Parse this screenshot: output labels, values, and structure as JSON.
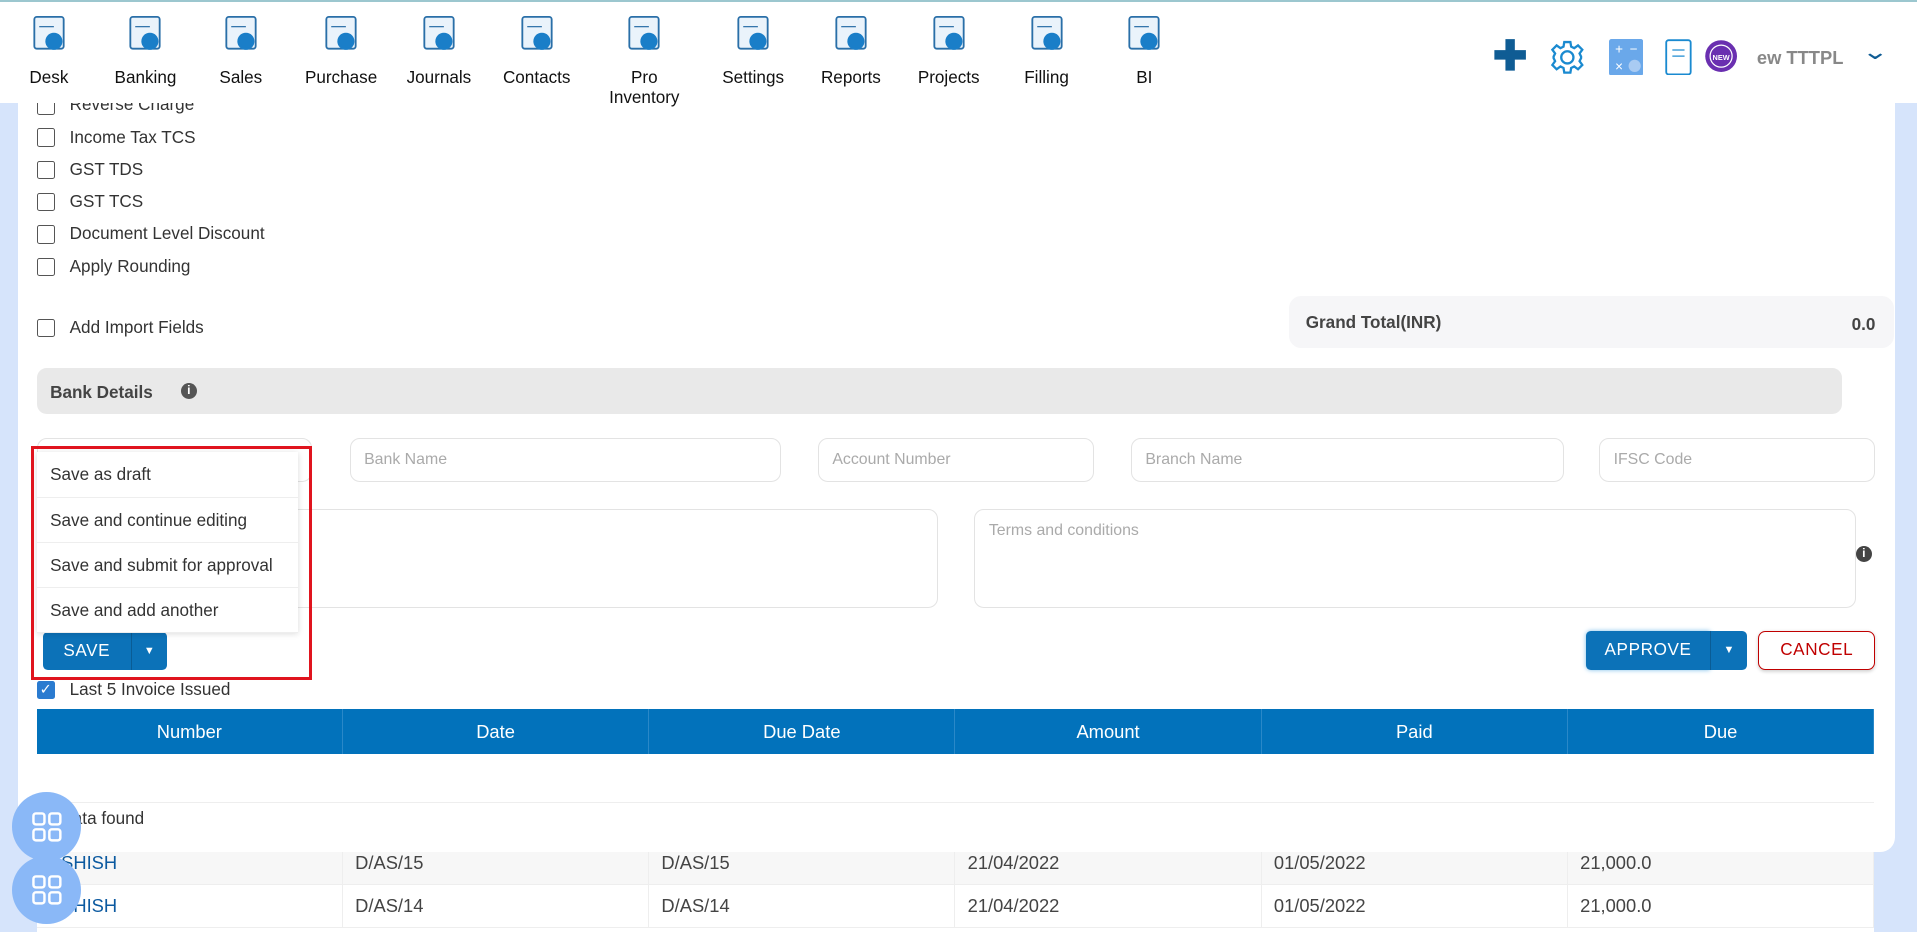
{
  "nav": {
    "items": [
      {
        "label": "Desk",
        "icon": "desk-icon"
      },
      {
        "label": "Banking",
        "icon": "bank-icon"
      },
      {
        "label": "Sales",
        "icon": "sales-icon"
      },
      {
        "label": "Purchase",
        "icon": "purchase-icon"
      },
      {
        "label": "Journals",
        "icon": "journals-icon"
      },
      {
        "label": "Contacts",
        "icon": "contacts-icon"
      },
      {
        "label": "Pro Inventory",
        "icon": "inventory-icon"
      },
      {
        "label": "Settings",
        "icon": "settings-icon"
      },
      {
        "label": "Reports",
        "icon": "reports-icon"
      },
      {
        "label": "Projects",
        "icon": "projects-icon"
      },
      {
        "label": "Filling",
        "icon": "filling-icon"
      },
      {
        "label": "BI",
        "icon": "bi-icon"
      }
    ],
    "company": "ew TTTPL",
    "new_badge": "NEW"
  },
  "options": [
    {
      "label": "Reverse Charge",
      "checked": false
    },
    {
      "label": "Income Tax TCS",
      "checked": false
    },
    {
      "label": "GST TDS",
      "checked": false
    },
    {
      "label": "GST TCS",
      "checked": false
    },
    {
      "label": "Document Level Discount",
      "checked": false
    },
    {
      "label": "Apply Rounding",
      "checked": false
    }
  ],
  "import_fields": "Add Import Fields",
  "grand_total": {
    "label": "Grand Total(INR)",
    "value": "0.0"
  },
  "bank_details": {
    "title": "Bank Details",
    "bank_name": "Bank Name",
    "account_number": "Account Number",
    "branch_name": "Branch Name",
    "ifsc": "IFSC Code"
  },
  "terms_placeholder": "Terms and conditions",
  "save_menu": [
    "Save as draft",
    "Save and continue editing",
    "Save and submit for approval",
    "Save and add another"
  ],
  "buttons": {
    "save": "SAVE",
    "approve": "APPROVE",
    "cancel": "CANCEL"
  },
  "last_invoices": {
    "label": "Last 5 Invoice Issued",
    "checked": true,
    "columns": [
      "Number",
      "Date",
      "Due Date",
      "Amount",
      "Paid",
      "Due"
    ],
    "empty": "No data found"
  },
  "background_rows": [
    [
      "ASHISH",
      "D/AS/15",
      "D/AS/15",
      "21/04/2022",
      "01/05/2022",
      "21,000.0"
    ],
    [
      "ASHISH",
      "D/AS/14",
      "D/AS/14",
      "21/04/2022",
      "01/05/2022",
      "21,000.0"
    ]
  ],
  "colors": {
    "primary": "#0272bb",
    "cancel": "#c00000",
    "highlight": "#e0141e"
  }
}
